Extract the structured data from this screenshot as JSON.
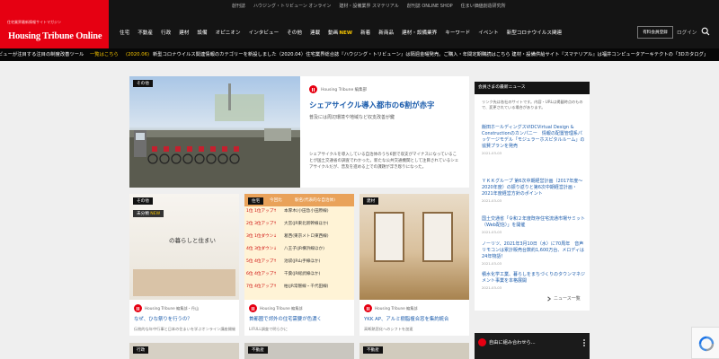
{
  "header": {
    "logo_tagline": "住宅業界最新情報サイトマガジン",
    "logo_text": "Housing Tribune Online",
    "top_links": [
      "創刊誌",
      "ハウジング・トリビューン オンライン",
      "建材・設備業界 スマテリアル",
      "創刊誌 ONLINE SHOP",
      "住まい価値創造研究所"
    ],
    "nav": [
      "住宅",
      "不動産",
      "行政",
      "建材",
      "設備",
      "オピニオン",
      "インタビュー",
      "その他",
      "連載",
      "動画",
      "新着",
      "新商品",
      "建材・設備業界",
      "キーワード",
      "イベント",
      "新型コロナウイルス関連"
    ],
    "nav_new_badge": "NEW",
    "member_button": "有料会員登録",
    "login": "ログイン",
    "colors": {
      "brand": "#e60012",
      "header_bg": "#141414",
      "link": "#1a5bab"
    }
  },
  "ticker": {
    "part1": "ビューが注目する注目の制度改善ツール",
    "hl1": "一覧はこちら",
    "date1": "(2020.06)",
    "part2": "新型コロナウイルス関連情報のカテゴリーを新設しました（2020.04）住宅業界総合誌『ハウジング・トリビューン』は隔週金曜発売。ご購入・年間定期購読はこちら 建材・設備供給サイト『スマテリアル』は福井コンピュータアーキテクトの「3Dカタログ」"
  },
  "featured": {
    "tag": "その他",
    "meta": "Housing Tribune 編集部",
    "title": "シェアサイクル導入都市の6割が赤字",
    "subtitle": "普及には周辺環境や地域など収支改善が鍵",
    "body": "シェアサイクルを導入している自治体のうち6割で収支がマイナスになっていることが国土交通省の調査でわかった。新たな公共交通機関として注目されているシェアサイクルだが、普及を進める上での課題が浮き彫りになった。"
  },
  "cards": [
    {
      "tag": "その他",
      "tag2": "未分類",
      "tag2_badge": "NEW",
      "meta": "Housing Tribune 編集部・丹山",
      "title": "なぜ、ひな祭りを行うの？",
      "sub": "伝統的な年中行事と日本の住まいを学ぶオンライン講座開催",
      "image_caption": "の暮らしと住まい"
    },
    {
      "tag": "住宅",
      "meta": "Housing Tribune 編集部",
      "title": "首都圏で郊外の住宅需要が色濃く",
      "sub": "LIFULL調査で明らかに",
      "ranking_head": [
        "今回比",
        "駅名(代表的な自治体)"
      ],
      "ranking": [
        {
          "rank": "1位",
          "change": "1位アップ↑",
          "name": "本厚木(小田急小田原線)"
        },
        {
          "rank": "2位",
          "change": "3位アップ↑",
          "name": "大宮(JR東北新幹線ほか)"
        },
        {
          "rank": "3位",
          "change": "1位ダウン↓",
          "name": "葛西(東京メトロ東西線)"
        },
        {
          "rank": "4位",
          "change": "3位ダウン↓",
          "name": "八王子(JR横浜線ほか)"
        },
        {
          "rank": "5位",
          "change": "4位アップ↑",
          "name": "池袋(JR山手線ほか)"
        },
        {
          "rank": "6位",
          "change": "4位アップ↑",
          "name": "千葉(JR総武線ほか)"
        },
        {
          "rank": "7位",
          "change": "4位アップ↑",
          "name": "柏(JR常磐線・千代田線)"
        }
      ]
    },
    {
      "tag": "建材",
      "meta": "Housing Tribune 編集部",
      "title": "YKK AP、アルミ樹脂複合窓を集約統合",
      "sub": "高断熱窓化へのシフトを加速"
    }
  ],
  "sidebar": {
    "title": "会員さまの最新ニュース",
    "intro": "リンク先は各社のサイトです。内容・URLは掲載時点のもので、変更されている場合があります。",
    "items": [
      {
        "title": "飯田ホールディングスVIDCVirtual Design & Constructionのカンパニー　情報の配置管理系パッケージモデル「モジュラーホスピタルルーム」の協賛プランを発売",
        "date": "2021-03-03"
      },
      {
        "title": "ＹＫＫグループ 第6次中期経営計画（2017年度〜2020年度）の振り返りと第6次中期経営計画・2021年度経営方針のポイント",
        "date": "2021-03-03"
      },
      {
        "title": "国土交通省「令和２年度既存住宅流通市場サミット（Web配信）」を開催",
        "date": "2021-03-03"
      },
      {
        "title": "ノーリツ、2021年3月10日（水）に70周年　音声リモコンは累計販売台数約1,600万台、メロディは24年物語！",
        "date": "2021-03-03"
      },
      {
        "title": "積水化学工業、暮らしをまちづくりのタウンマネジメント事業を本格展開",
        "date": "2021-03-03"
      }
    ],
    "more": "ニュース一覧"
  },
  "bottom": {
    "tags": [
      "行政",
      "不動産",
      "不動産"
    ],
    "video_title": "自由に組み合わせら..."
  }
}
